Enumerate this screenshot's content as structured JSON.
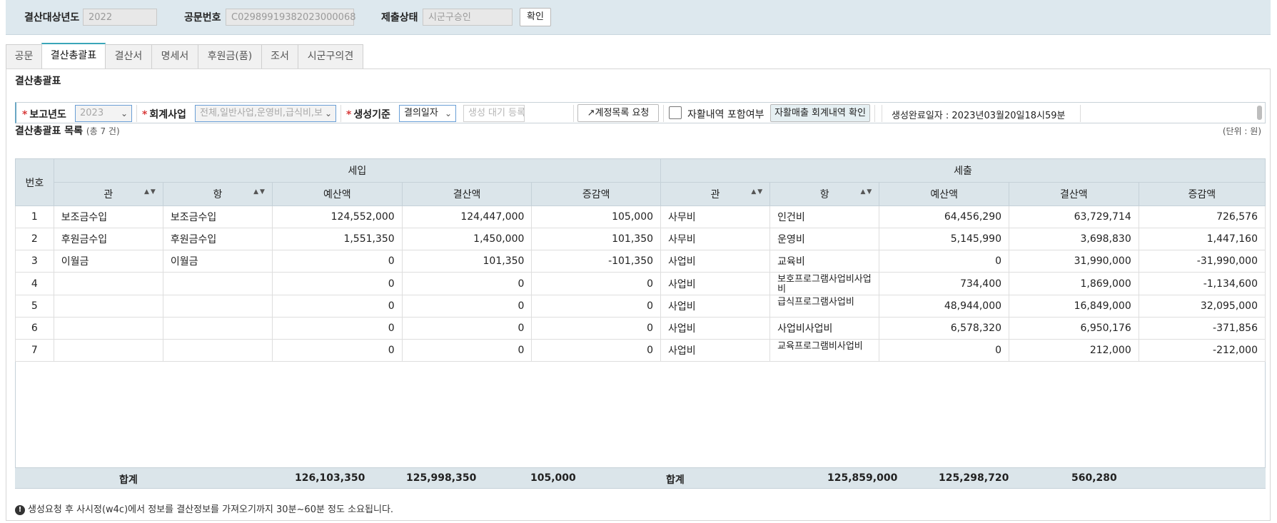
{
  "header": {
    "year_label": "결산대상년도",
    "year_value": "2022",
    "docno_label": "공문번호",
    "docno_value": "C02989919382023000068",
    "status_label": "제출상태",
    "status_value": "시군구승인",
    "confirm_button": "확인"
  },
  "tabs": [
    {
      "label": "공문"
    },
    {
      "label": "결산총괄표",
      "active": true
    },
    {
      "label": "결산서"
    },
    {
      "label": "명세서"
    },
    {
      "label": "후원금(품)"
    },
    {
      "label": "조서"
    },
    {
      "label": "시군구의견"
    }
  ],
  "section_title": "결산총괄표",
  "filter": {
    "report_year_label": "보고년도",
    "report_year_value": "2023",
    "account_label": "회계사업",
    "account_value": "전체,일반사업,운영비,급식비,보",
    "basis_label": "생성기준",
    "basis_value": "결의일자",
    "generate_placeholder": "생성 대기 등록",
    "request_button": "계정목록 요청",
    "include_label": "자활내역 포함여부",
    "check_button": "자활매출 회계내역 확인",
    "completed_text": "생성완료일자 : 2023년03월20일18시59분"
  },
  "list": {
    "title": "결산총괄표 목록",
    "count_text": "(총 7 건)",
    "unit_text": "(단위 : 원)"
  },
  "table": {
    "no_header": "번호",
    "income_header": "세입",
    "expense_header": "세출",
    "sub_headers": [
      "관",
      "항",
      "예산액",
      "결산액",
      "증감액",
      "관",
      "항",
      "예산액",
      "결산액",
      "증감액"
    ],
    "rows": [
      [
        "1",
        "보조금수입",
        "보조금수입",
        "124,552,000",
        "124,447,000",
        "105,000",
        "사무비",
        "인건비",
        "64,456,290",
        "63,729,714",
        "726,576"
      ],
      [
        "2",
        "후원금수입",
        "후원금수입",
        "1,551,350",
        "1,450,000",
        "101,350",
        "사무비",
        "운영비",
        "5,145,990",
        "3,698,830",
        "1,447,160"
      ],
      [
        "3",
        "이월금",
        "이월금",
        "0",
        "101,350",
        "-101,350",
        "사업비",
        "교육비",
        "0",
        "31,990,000",
        "-31,990,000"
      ],
      [
        "4",
        "",
        "",
        "0",
        "0",
        "0",
        "사업비",
        "보호프로그램사업비사업비",
        "734,400",
        "1,869,000",
        "-1,134,600"
      ],
      [
        "5",
        "",
        "",
        "0",
        "0",
        "0",
        "사업비",
        "급식프로그램사업비",
        "48,944,000",
        "16,849,000",
        "32,095,000"
      ],
      [
        "6",
        "",
        "",
        "0",
        "0",
        "0",
        "사업비",
        "사업비사업비",
        "6,578,320",
        "6,950,176",
        "-371,856"
      ],
      [
        "7",
        "",
        "",
        "0",
        "0",
        "0",
        "사업비",
        "교육프로그램비사업비",
        "0",
        "212,000",
        "-212,000"
      ]
    ],
    "total_label_income": "합계",
    "total_income_budget": "126,103,350",
    "total_income_settle": "125,998,350",
    "total_income_diff": "105,000",
    "total_label_expense": "합계",
    "total_expense_budget": "125,859,000",
    "total_expense_settle": "125,298,720",
    "total_expense_diff": "560,280"
  },
  "note_text": "생성요청 후 사시정(w4c)에서 정보를 결산정보를 가져오기까지 30분~60분 정도 소요됩니다."
}
